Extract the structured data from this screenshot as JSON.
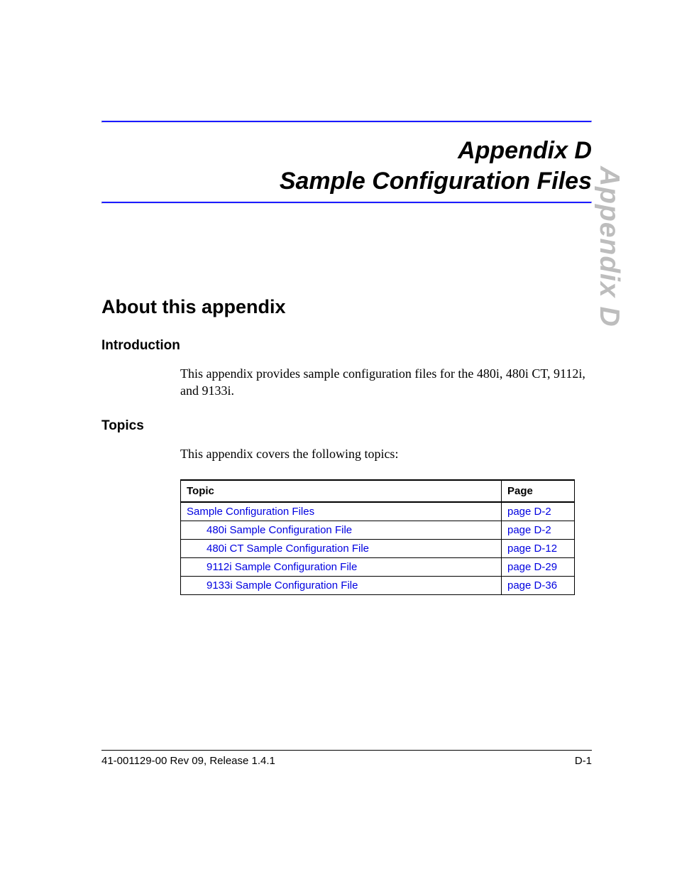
{
  "side_tab": "Appendix D",
  "title": {
    "line1": "Appendix D",
    "line2": "Sample Configuration Files"
  },
  "section_heading": "About this appendix",
  "intro": {
    "heading": "Introduction",
    "text": "This appendix provides sample configuration files for the 480i, 480i CT, 9112i, and 9133i."
  },
  "topics": {
    "heading": "Topics",
    "lead": "This appendix covers the following topics:",
    "header_topic": "Topic",
    "header_page": "Page",
    "rows": [
      {
        "topic": "Sample Configuration Files",
        "page": "page D-2",
        "indent": 0
      },
      {
        "topic": "480i Sample Configuration File",
        "page": "page D-2",
        "indent": 1
      },
      {
        "topic": "480i CT Sample Configuration File",
        "page": "page D-12",
        "indent": 1
      },
      {
        "topic": "9112i Sample Configuration File",
        "page": "page D-29",
        "indent": 1
      },
      {
        "topic": "9133i Sample Configuration File",
        "page": "page D-36",
        "indent": 1
      }
    ]
  },
  "footer": {
    "left": "41-001129-00 Rev 09, Release 1.4.1",
    "right": "D-1"
  }
}
